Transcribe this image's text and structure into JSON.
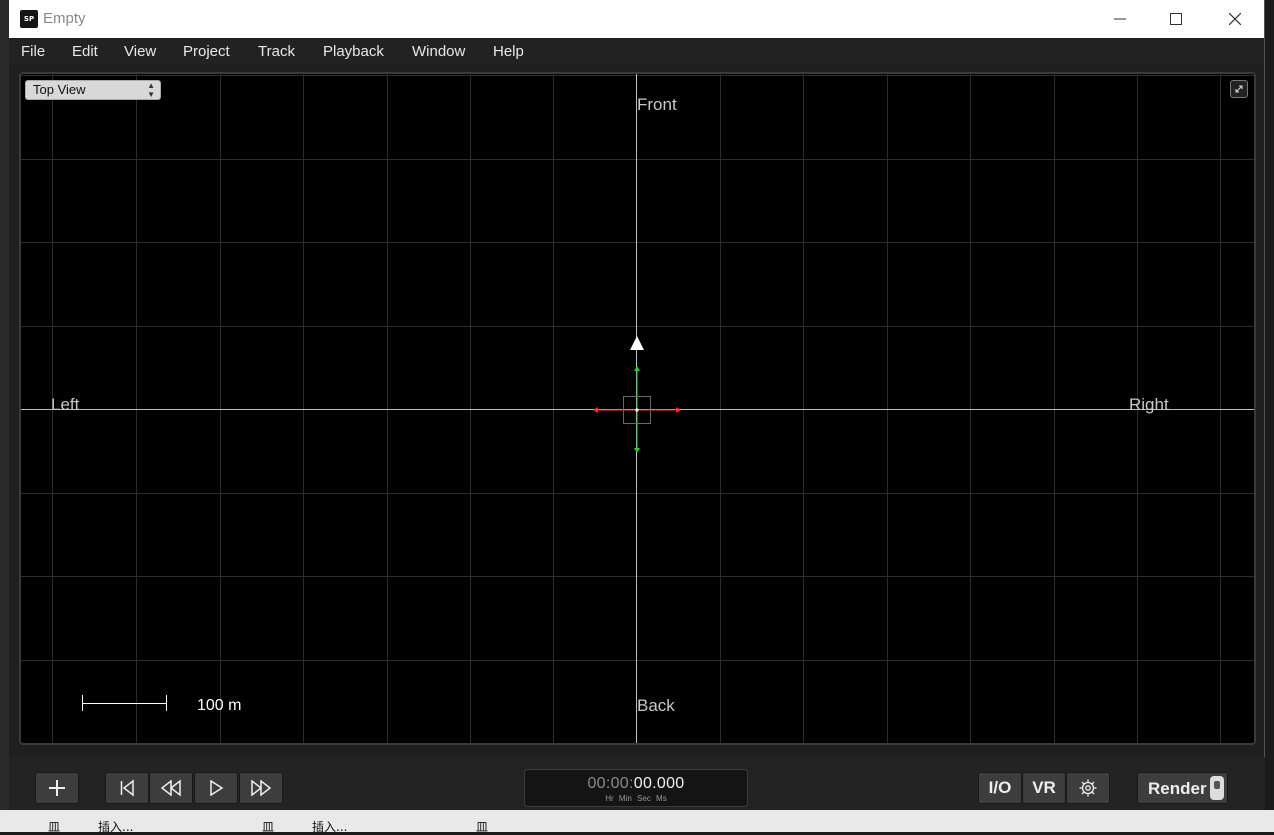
{
  "window": {
    "title": "Empty",
    "app_icon_text": "SP",
    "controls": [
      "minimize",
      "maximize",
      "close"
    ]
  },
  "menu": [
    "File",
    "Edit",
    "View",
    "Project",
    "Track",
    "Playback",
    "Window",
    "Help"
  ],
  "viewport": {
    "view_select": "Top View",
    "labels": {
      "front": "Front",
      "back": "Back",
      "left": "Left",
      "right": "Right"
    },
    "scale_label": "100 m"
  },
  "transport": {
    "time_dim": "00:00:",
    "time_bright": "00.000",
    "time_units": "Hr Min Sec Ms",
    "io_label": "I/O",
    "vr_label": "VR",
    "render_label": "Render"
  },
  "host_background": {
    "fragments": [
      "皿",
      "插入...",
      "皿",
      "插入...",
      "皿"
    ]
  },
  "colors": {
    "x_axis": "#ff2b2b",
    "y_axis": "#2ecc2e",
    "grid": "#2c2c2c",
    "axis_line": "#bfbfbf"
  }
}
